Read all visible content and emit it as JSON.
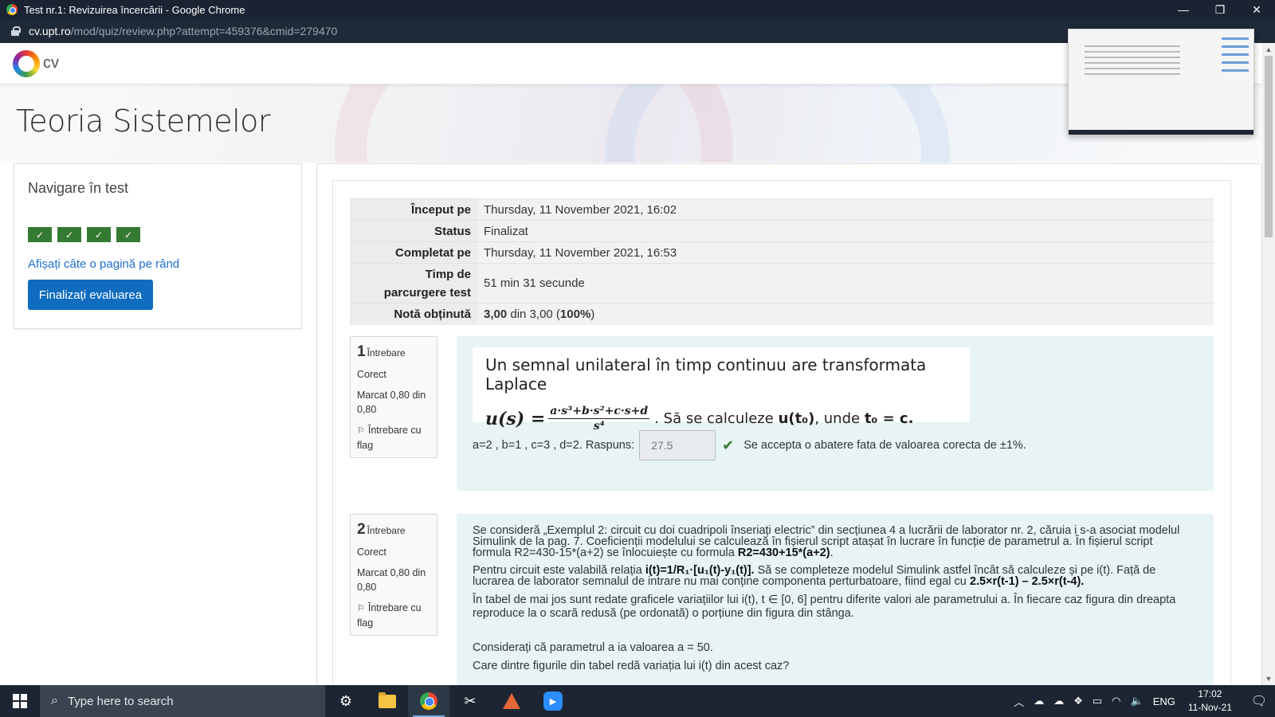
{
  "window": {
    "title": "Test nr.1: Revizuirea încercării - Google Chrome",
    "minimize": "—",
    "restore": "❐",
    "close": "✕"
  },
  "address": {
    "host": "cv.upt.ro",
    "path": "/mod/quiz/review.php?attempt=459376&cmid=279470"
  },
  "site": {
    "logo_text": "cv"
  },
  "course": {
    "title": "Teoria Sistemelor"
  },
  "quiz_nav": {
    "title": "Navigare în test",
    "check_glyph": "✓",
    "show_one_page_link": "Afișați câte o pagină pe rând",
    "finish_button": "Finalizați evaluarea"
  },
  "summary": {
    "started_label": "Început pe",
    "started_value": "Thursday, 11 November 2021, 16:02",
    "status_label": "Status",
    "status_value": "Finalizat",
    "completed_label": "Completat pe",
    "completed_value": "Thursday, 11 November 2021, 16:53",
    "time_label_1": "Timp de",
    "time_label_2": "parcurgere test",
    "time_value": "51 min 31 secunde",
    "grade_label": "Notă obținută",
    "grade_score": "3,00",
    "grade_mid": " din 3,00 (",
    "grade_percent": "100%",
    "grade_end": ")"
  },
  "questions": [
    {
      "number": "1",
      "label": "Întrebare",
      "state": "Corect",
      "mark": "Marcat 0,80 din 0,80",
      "flag": "Întrebare cu flag",
      "title": "Un semnal unilateral în timp continuu are transformata Laplace",
      "formula_lhs": "u(s) =",
      "formula_num": "a·s³+b·s²+c·s+d",
      "formula_den": "s⁴",
      "formula_rest_1": ". Să se calculeze ",
      "formula_u": "u(t₀)",
      "formula_rest_2": ", unde ",
      "formula_t": "t₀ = c.",
      "params": "a=2 , b=1 , c=3 , d=2. Raspuns:",
      "answer": "27.5",
      "check": "✔",
      "feedback": "Se accepta o abatere fata de valoarea corecta de ±1%."
    },
    {
      "number": "2",
      "label": "Întrebare",
      "state": "Corect",
      "mark": "Marcat 0,80 din 0,80",
      "flag": "Întrebare cu flag",
      "p1_a": "Se consideră „Exemplul 2: circuit cu doi cuadripoli înseriați electric” din secțiunea 4 a lucrării de laborator nr. 2, căruia i s-a asociat modelul Simulink de la pag. 7. Coeficienții modelului se calculează în fișierul script atașat în lucrare în funcție de parametrul a. În fișierul script formula R2=430-15*(a+2) se înlocuiește cu formula ",
      "p1_b": "R2=430+15*(a+2)",
      "p1_c": ".",
      "p2_a": "Pentru circuit este valabilă relația ",
      "p2_b": "i(t)=1/R₁·[u₁(t)-y₁(t)].",
      "p2_c": " Să se completeze modelul Simulink astfel încât să calculeze și pe i(t). Față de lucrarea de laborator semnalul de intrare nu mai conține componenta perturbatoare, fiind egal cu ",
      "p2_d": "2.5×r(t-1) – 2.5×r(t-4).",
      "p3": "În tabel de mai jos sunt redate graficele variațiilor lui i(t), t ∈ [0, 6] pentru diferite valori ale parametrului a. În fiecare caz figura din dreapta reproduce la o scară redusă (pe ordonată) o porțiune din figura din stânga.",
      "p4": "Considerați că parametrul a ia valoarea a = 50.",
      "p5": "Care dintre figurile din tabel redă variația lui i(t) din acest caz?"
    }
  ],
  "taskbar": {
    "search_placeholder": "Type here to search",
    "lang": "ENG",
    "time": "17:02",
    "date": "11-Nov-21"
  }
}
